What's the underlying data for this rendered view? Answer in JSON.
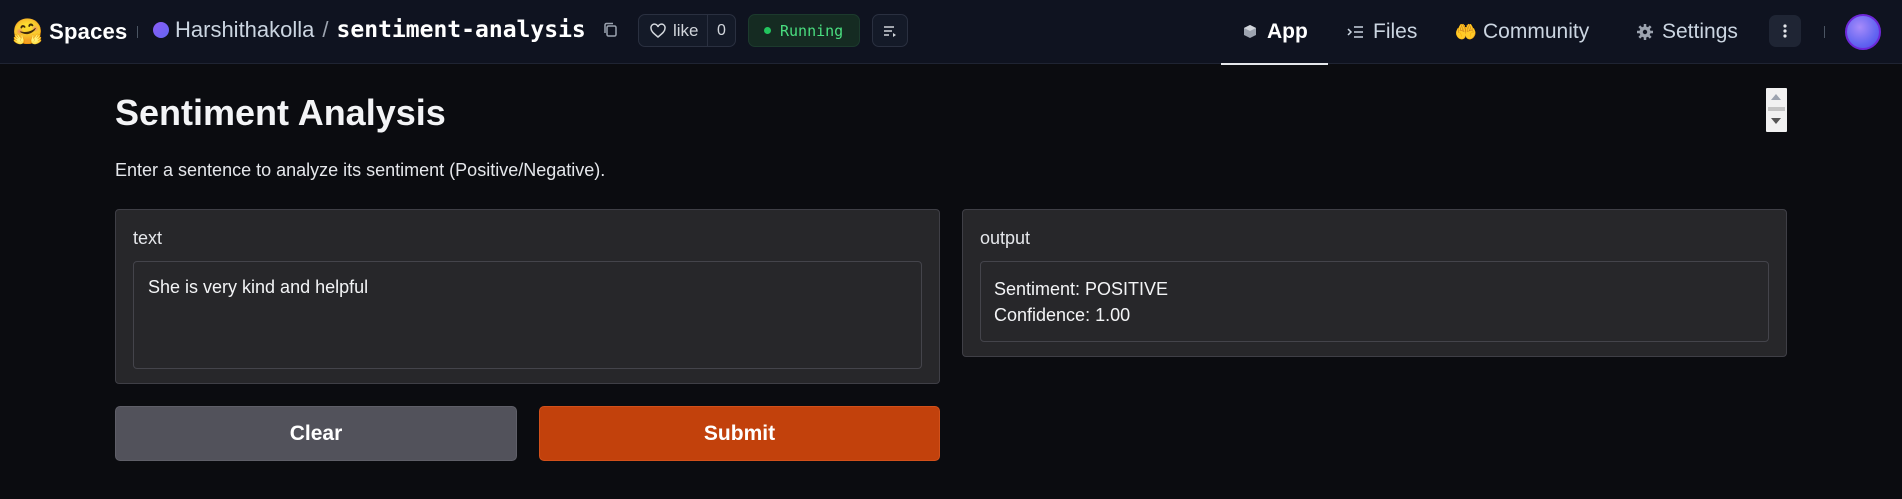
{
  "header": {
    "brand_icon": "🤗",
    "brand_label": "Spaces",
    "owner": "Harshithakolla",
    "separator": "/",
    "repo": "sentiment-analysis",
    "like_label": "like",
    "like_count": "0",
    "status": "Running",
    "status_color": "#22c55e"
  },
  "nav": {
    "tabs": [
      {
        "label": "App",
        "icon": "cube-icon",
        "active": true
      },
      {
        "label": "Files",
        "icon": "files-icon",
        "active": false
      },
      {
        "label": "Community",
        "icon": "community-icon",
        "active": false
      },
      {
        "label": "Settings",
        "icon": "gear-icon",
        "active": false
      }
    ]
  },
  "app": {
    "title": "Sentiment Analysis",
    "description": "Enter a sentence to analyze its sentiment (Positive/Negative).",
    "input": {
      "label": "text",
      "value": "She is very kind and helpful"
    },
    "output": {
      "label": "output",
      "line1": "Sentiment: POSITIVE",
      "line2": "Confidence: 1.00"
    },
    "buttons": {
      "clear": "Clear",
      "submit": "Submit"
    },
    "accent_color": "#c2410c"
  }
}
